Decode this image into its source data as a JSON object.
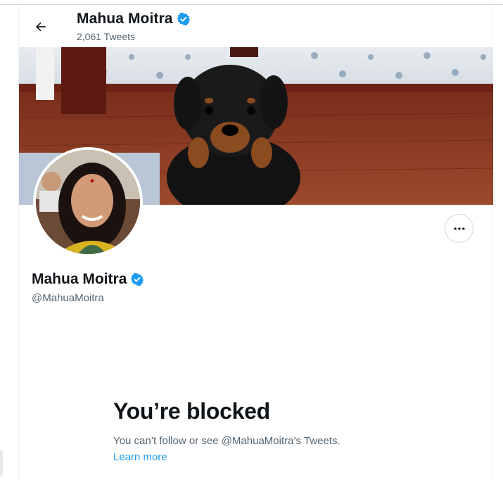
{
  "header": {
    "name": "Mahua Moitra",
    "tweet_count": "2,061 Tweets"
  },
  "profile": {
    "name": "Mahua Moitra",
    "handle": "@MahuaMoitra"
  },
  "blocked": {
    "title": "You’re blocked",
    "message": "You can’t follow or see @MahuaMoitra’s Tweets.",
    "link": "Learn more"
  },
  "colors": {
    "accent": "#1d9bf0",
    "verified": "#1d9bf0",
    "text_primary": "#0f1419",
    "text_secondary": "#536471"
  },
  "icons": {
    "back": "arrow-left-icon",
    "verified": "verified-badge-icon",
    "more": "more-horizontal-icon"
  }
}
